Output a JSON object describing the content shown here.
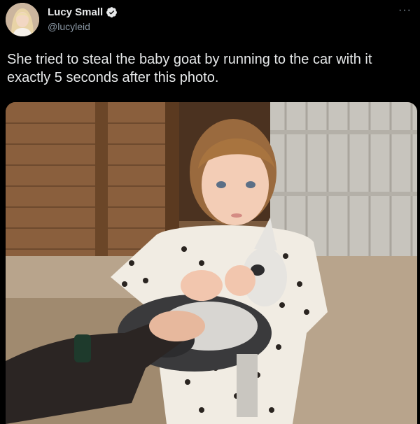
{
  "author": {
    "display_name": "Lucy Small",
    "handle": "@lucyleid",
    "verified": true,
    "avatar_icon": "profile-photo"
  },
  "more_icon": "more-options-icon",
  "more_label": "···",
  "tweet": {
    "text": "She tried to steal the baby goat by running to the car with it exactly 5 seconds after this photo."
  },
  "colors": {
    "background": "#000000",
    "text": "#e7e9ea",
    "muted": "#8b98a5",
    "verified_blue": "#1d9bf0"
  },
  "media": {
    "description_icon": "photo-toddler-holding-baby-goat"
  }
}
